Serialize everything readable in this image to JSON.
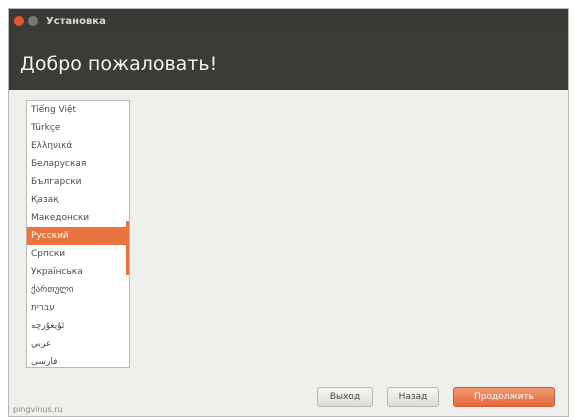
{
  "window": {
    "title": "Установка"
  },
  "banner": {
    "title": "Добро пожаловать!"
  },
  "languages": [
    {
      "label": "Tiếng Việt",
      "selected": false
    },
    {
      "label": "Türkçe",
      "selected": false
    },
    {
      "label": "Ελληνικά",
      "selected": false
    },
    {
      "label": "Беларуская",
      "selected": false
    },
    {
      "label": "Български",
      "selected": false
    },
    {
      "label": "Қазақ",
      "selected": false
    },
    {
      "label": "Македонски",
      "selected": false
    },
    {
      "label": "Русский",
      "selected": true
    },
    {
      "label": "Српски",
      "selected": false
    },
    {
      "label": "Українська",
      "selected": false
    },
    {
      "label": "ქართული",
      "selected": false
    },
    {
      "label": "עברית",
      "selected": false
    },
    {
      "label": "ئۇيغۇرچە",
      "selected": false
    },
    {
      "label": "عربي",
      "selected": false
    },
    {
      "label": "فارسی",
      "selected": false
    }
  ],
  "buttons": {
    "quit": "Выход",
    "back": "Назад",
    "continue": "Продолжить"
  },
  "statusbar": {
    "text": "pingvinus.ru"
  },
  "colors": {
    "accent": "#e9743f",
    "titlebar": "#3b3a36",
    "background": "#efefec"
  }
}
